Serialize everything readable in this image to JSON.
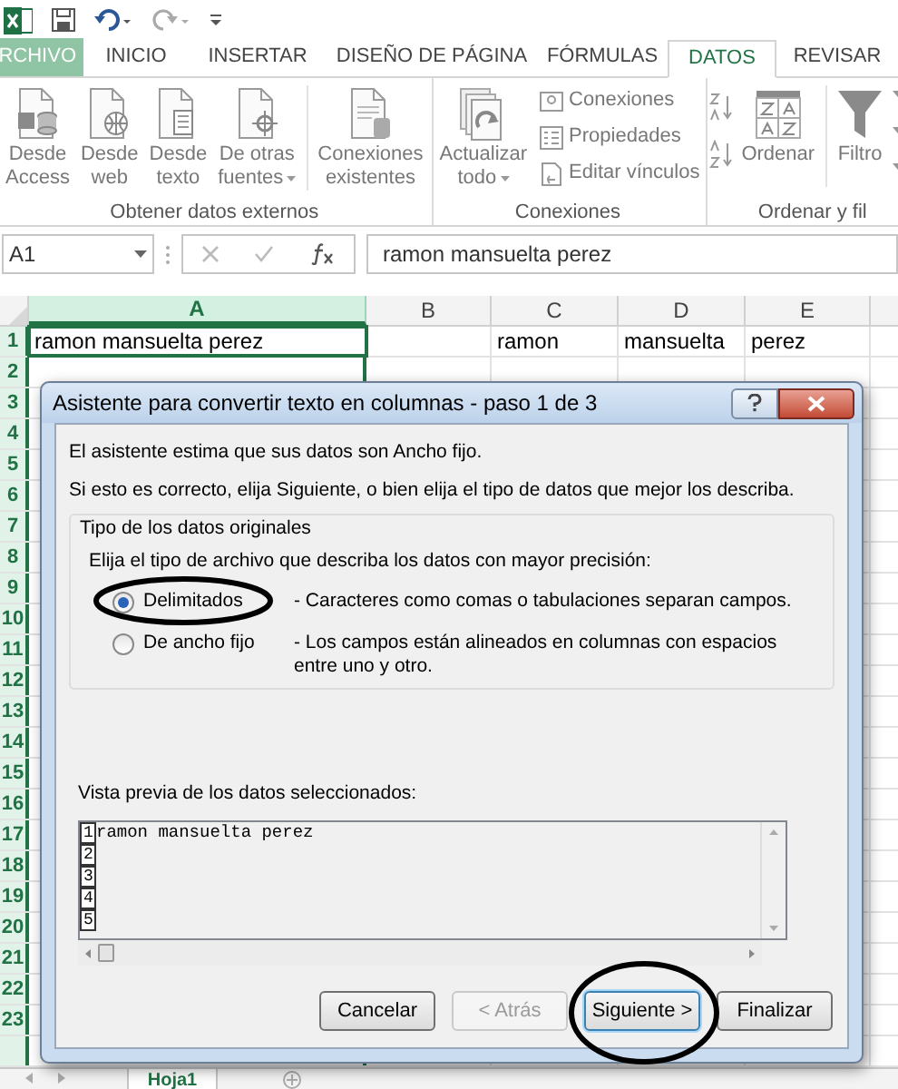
{
  "tabs": [
    {
      "label": "RCHIVO",
      "kind": "file",
      "selected": false
    },
    {
      "label": "INICIO",
      "kind": "tab",
      "selected": false
    },
    {
      "label": "INSERTAR",
      "kind": "tab",
      "selected": false
    },
    {
      "label": "DISEÑO DE PÁGINA",
      "kind": "tab",
      "selected": false
    },
    {
      "label": "FÓRMULAS",
      "kind": "tab",
      "selected": false
    },
    {
      "label": "DATOS",
      "kind": "tab",
      "selected": true
    },
    {
      "label": "REVISAR",
      "kind": "tab",
      "selected": false
    }
  ],
  "ribbon_groups": [
    {
      "label": "Obtener datos externos",
      "sections": [
        [
          {
            "kind": "large",
            "lines": [
              "Desde",
              "Access"
            ],
            "dropdown": false
          },
          {
            "kind": "large",
            "lines": [
              "Desde",
              "web"
            ],
            "dropdown": false
          },
          {
            "kind": "large",
            "lines": [
              "Desde",
              "texto"
            ],
            "dropdown": false
          },
          {
            "kind": "large",
            "lines": [
              "De otras",
              "fuentes"
            ],
            "dropdown": true
          }
        ],
        [
          {
            "kind": "large",
            "lines": [
              "Conexiones",
              "existentes"
            ],
            "dropdown": false
          }
        ]
      ]
    },
    {
      "label": "Conexiones",
      "sections": [
        [
          {
            "kind": "large",
            "lines": [
              "Actualizar",
              "todo"
            ],
            "dropdown": true
          },
          {
            "kind": "stack",
            "entries": [
              "Conexiones",
              "Propiedades",
              "Editar vínculos"
            ]
          }
        ]
      ]
    },
    {
      "label": "Ordenar y fil",
      "sections": [
        [
          {
            "kind": "sort"
          },
          {
            "kind": "large",
            "lines": [
              "Ordenar"
            ],
            "dropdown": false
          }
        ],
        [
          {
            "kind": "large",
            "lines": [
              "Filtro"
            ],
            "dropdown": false
          },
          {
            "kind": "filters"
          }
        ]
      ]
    }
  ],
  "formula_bar": {
    "name_box": "A1",
    "formula": "ramon mansuelta perez"
  },
  "sheet": {
    "columns": [
      {
        "label": "A",
        "selected": true
      },
      {
        "label": "B",
        "selected": false
      },
      {
        "label": "C",
        "selected": false
      },
      {
        "label": "D",
        "selected": false
      },
      {
        "label": "E",
        "selected": false
      }
    ],
    "row_numbers": [
      "1",
      "2",
      "3",
      "4",
      "5",
      "6",
      "7",
      "8",
      "9",
      "10",
      "11",
      "12",
      "13",
      "14",
      "15",
      "16",
      "17",
      "18",
      "19",
      "20",
      "21",
      "22",
      "23"
    ],
    "row_1": [
      {
        "text": "ramon mansuelta perez",
        "active": true
      },
      {
        "active": false
      },
      {
        "text": "ramon",
        "active": false
      },
      {
        "text": "mansuelta",
        "active": false
      },
      {
        "text": "perez",
        "active": false
      }
    ],
    "sheet_tab": "Hoja1"
  },
  "dialog": {
    "title": "Asistente para convertir texto en columnas - paso 1 de 3",
    "intro": [
      "El asistente estima que sus datos son Ancho fijo.",
      "Si esto es correcto, elija Siguiente, o bien elija el tipo de datos que mejor los describa."
    ],
    "group": {
      "legend": "Tipo de los datos originales",
      "prompt": "Elija el tipo de archivo que describa los datos con mayor precisión:",
      "options": [
        {
          "label": "Delimitados",
          "description": "- Caracteres como comas o tabulaciones separan campos.",
          "selected": true
        },
        {
          "label": "De ancho fijo",
          "description": "- Los campos están alineados en columnas con espacios entre uno y otro.",
          "selected": false
        }
      ]
    },
    "preview": {
      "label": "Vista previa de los datos seleccionados:",
      "lines": [
        {
          "number": "1",
          "text": "ramon mansuelta perez"
        },
        {
          "number": "2"
        },
        {
          "number": "3"
        },
        {
          "number": "4"
        },
        {
          "number": "5"
        }
      ]
    },
    "buttons": [
      {
        "label": "Cancelar",
        "disabled": false,
        "default": false
      },
      {
        "label": "< Atrás",
        "disabled": true,
        "default": false
      },
      {
        "label": "Siguiente >",
        "disabled": false,
        "default": true
      },
      {
        "label": "Finalizar",
        "disabled": false,
        "default": false
      }
    ]
  }
}
